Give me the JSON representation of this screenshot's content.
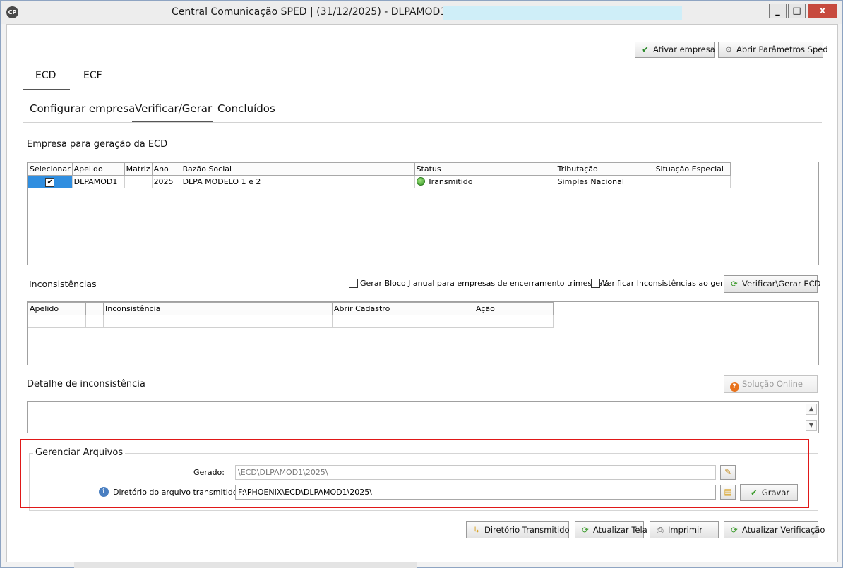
{
  "window": {
    "icon": "CP",
    "title": "Central Comunicação SPED | (31/12/2025) - DLPAMOD1 -",
    "minimize": "_",
    "maximize": "□",
    "close": "x"
  },
  "toolbar": {
    "activate_company": "Ativar empresa",
    "open_parameters": "Abrir Parâmetros Sped"
  },
  "main_tabs": [
    {
      "label": "ECD",
      "active": true
    },
    {
      "label": "ECF",
      "active": false
    }
  ],
  "sub_tabs": [
    {
      "label": "Configurar empresa",
      "active": false
    },
    {
      "label": "Verificar/Gerar",
      "active": true
    },
    {
      "label": "Concluídos",
      "active": false
    }
  ],
  "companies": {
    "section_title": "Empresa para geração da ECD",
    "columns": [
      "Selecionar",
      "Apelido",
      "Matriz",
      "Ano",
      "Razão Social",
      "Status",
      "Tributação",
      "Situação Especial"
    ],
    "rows": [
      {
        "selected": true,
        "apelido": "DLPAMOD1",
        "matriz": "",
        "ano": "2025",
        "razao_social": "DLPA MODELO 1 e 2",
        "status": "Transmitido",
        "tributacao": "Simples Nacional",
        "situacao_especial": ""
      }
    ]
  },
  "inconsistencies": {
    "section_title": "Inconsistências",
    "checkbox_bloco_j": "Gerar Bloco J anual para empresas de encerramento trimestrais",
    "checkbox_verify": "Verificar Inconsistências ao gerar",
    "verify_button": "Verificar\\Gerar ECD",
    "columns": [
      "Apelido",
      "",
      "Inconsistência",
      "Abrir Cadastro",
      "Ação"
    ]
  },
  "detail": {
    "section_title": "Detalhe de inconsistência",
    "online_solution": "Solução Online"
  },
  "files": {
    "group_title": "Gerenciar Arquivos",
    "generated_label": "Gerado:",
    "generated_value": "\\ECD\\DLPAMOD1\\2025\\",
    "transmitted_label": "Diretório do arquivo transmitido:",
    "transmitted_value": "F:\\PHOENIX\\ECD\\DLPAMOD1\\2025\\",
    "save_button": "Gravar"
  },
  "footer": {
    "transmitted_dir": "Diretório Transmitido",
    "refresh_screen": "Atualizar Tela",
    "print": "Imprimir",
    "refresh_verification": "Atualizar Verificação"
  },
  "colors": {
    "highlight": "#e01818",
    "selection": "#2f8ee0",
    "status_ok": "#3a9a2a"
  }
}
